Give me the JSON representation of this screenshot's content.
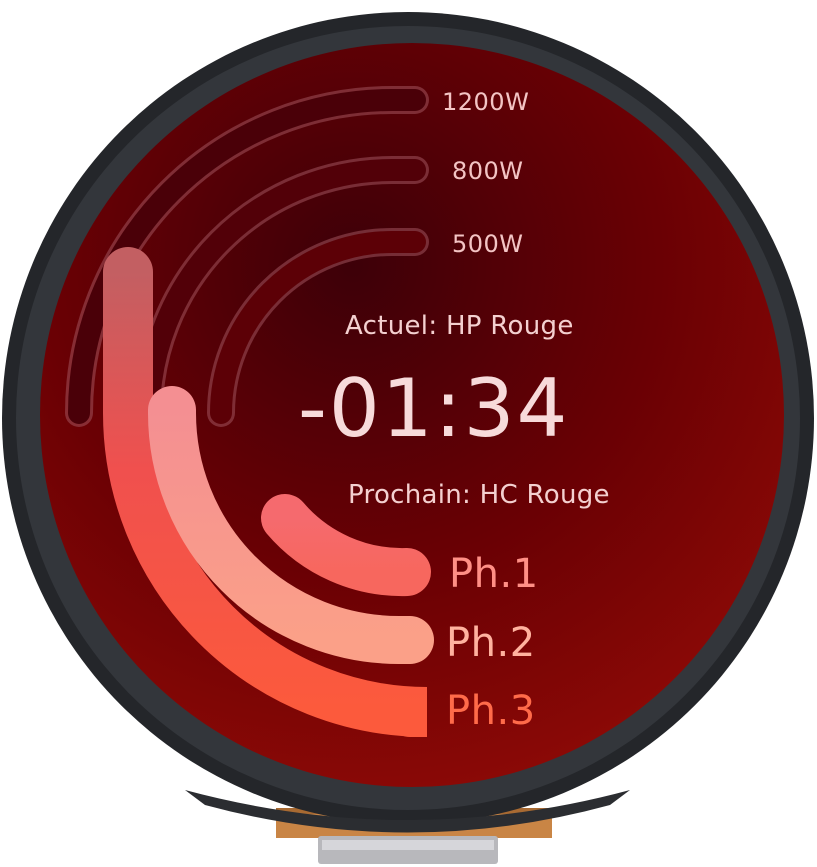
{
  "scale": {
    "labels": [
      "1200W",
      "800W",
      "500W"
    ]
  },
  "status": {
    "current_label": "Actuel: HP Rouge",
    "countdown": "-01:34",
    "next_label": "Prochain: HC Rouge"
  },
  "phases": [
    {
      "name": "Ph.1",
      "color": "#f76a64",
      "text_color": "#ff8f86"
    },
    {
      "name": "Ph.2",
      "color": "#fb9a8a",
      "text_color": "#ffb29f"
    },
    {
      "name": "Ph.3",
      "color": "#fb5a3e",
      "text_color": "#ff6b4a"
    }
  ],
  "theme": {
    "screen_color": "#7a0404",
    "bezel_color": "#2a2c31"
  }
}
